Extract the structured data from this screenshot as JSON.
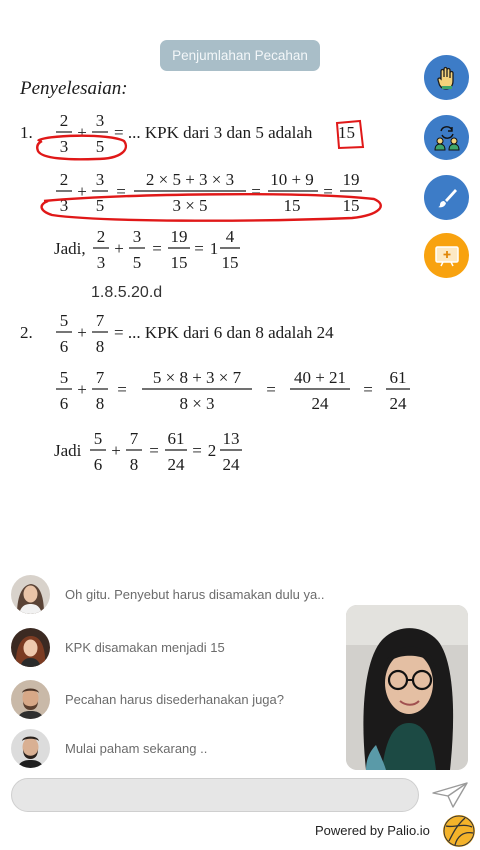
{
  "header": {
    "title": "Penjumlahan Pecahan"
  },
  "fabs": [
    {
      "icon": "raise-hand-icon",
      "color": "#3d7cc7"
    },
    {
      "icon": "switch-users-icon",
      "color": "#3d7cc7"
    },
    {
      "icon": "brush-icon",
      "color": "#3d7cc7"
    },
    {
      "icon": "whiteboard-icon",
      "color": "#f8a20f"
    }
  ],
  "board": {
    "heading": "Penyelesaian:",
    "p1": {
      "num": "1.",
      "a_num": "2",
      "a_den": "3",
      "plus": "+",
      "b_num": "3",
      "b_den": "5",
      "eq_tail": "= ... KPK dari 3 dan 5 adalah",
      "kpk": "15",
      "line2": {
        "n1": "2",
        "d1": "3",
        "n2": "3",
        "d2": "5",
        "expr_num": "2 × 5 + 3 × 3",
        "expr_den": "3 × 5",
        "r_num": "10 + 9",
        "r_den": "15",
        "f_num": "19",
        "f_den": "15"
      },
      "jadi": "Jadi,",
      "line3": {
        "n1": "2",
        "d1": "3",
        "n2": "3",
        "d2": "5",
        "r_num": "19",
        "r_den": "15",
        "whole": "1",
        "m_num": "4",
        "m_den": "15"
      },
      "ref": "1.8.5.20.d"
    },
    "p2": {
      "num": "2.",
      "a_num": "5",
      "a_den": "6",
      "b_num": "7",
      "b_den": "8",
      "eq_tail": "= ...  KPK dari 6 dan 8 adalah 24",
      "line2": {
        "n1": "5",
        "d1": "6",
        "n2": "7",
        "d2": "8",
        "expr_num": "5 × 8 + 3 × 7",
        "expr_den": "8 × 3",
        "r_num": "40 + 21",
        "r_den": "24",
        "f_num": "61",
        "f_den": "24"
      },
      "jadi": "Jadi",
      "line3": {
        "n1": "5",
        "d1": "6",
        "n2": "7",
        "d2": "8",
        "r_num": "61",
        "r_den": "24",
        "whole": "2",
        "m_num": "13",
        "m_den": "24"
      }
    },
    "highlight_color": "#e01818"
  },
  "chat": {
    "messages": [
      {
        "text": "Oh gitu. Penyebut harus disamakan dulu ya.."
      },
      {
        "text": "KPK disamakan menjadi 15"
      },
      {
        "text": "Pecahan harus disederhanakan juga?"
      },
      {
        "text": "Mulai paham sekarang .."
      }
    ],
    "input_placeholder": ""
  },
  "footer": {
    "powered_by": "Powered by Palio.io"
  }
}
